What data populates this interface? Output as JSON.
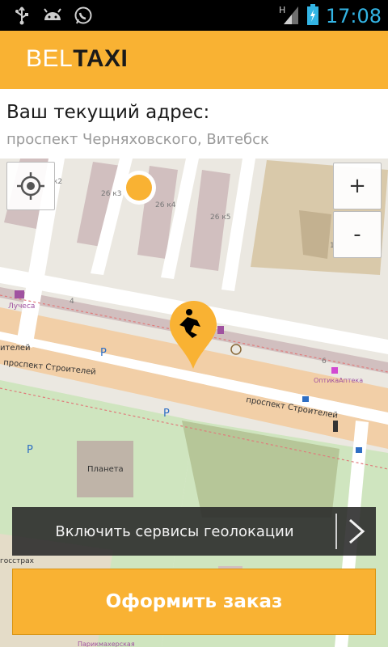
{
  "status_bar": {
    "icons": [
      "usb-icon",
      "android-icon",
      "whatsapp-icon",
      "signal-icon",
      "battery-icon"
    ],
    "time": "17:08",
    "network": "H"
  },
  "app_bar": {
    "logo_part1": "BEL",
    "logo_part2": "TAXI"
  },
  "address": {
    "label": "Ваш текущий адрес:",
    "value": "проспект Черняховского, Витебск"
  },
  "map": {
    "labels": {
      "k2": "к2",
      "k3": "26 к3",
      "k4": "26 к4",
      "k5": "26 к5",
      "one": "1",
      "four": "4",
      "six": "6",
      "luchesa": "Лучеса",
      "street_upper": "проспект Строителей",
      "street_lower": "проспект Строителей",
      "street_cut": "ителей",
      "pharmacy": "ОптикаАптека",
      "planeta": "Планета",
      "gosstrakh": "госстрах",
      "bottom": "Парикмахерская",
      "parking": "P"
    }
  },
  "controls": {
    "zoom_in": "+",
    "zoom_out": "-"
  },
  "geo_prompt": {
    "text": "Включить сервисы геолокации"
  },
  "order_button": {
    "label": "Оформить заказ"
  },
  "colors": {
    "accent": "#f9b233",
    "status_blue": "#33b5e5"
  }
}
